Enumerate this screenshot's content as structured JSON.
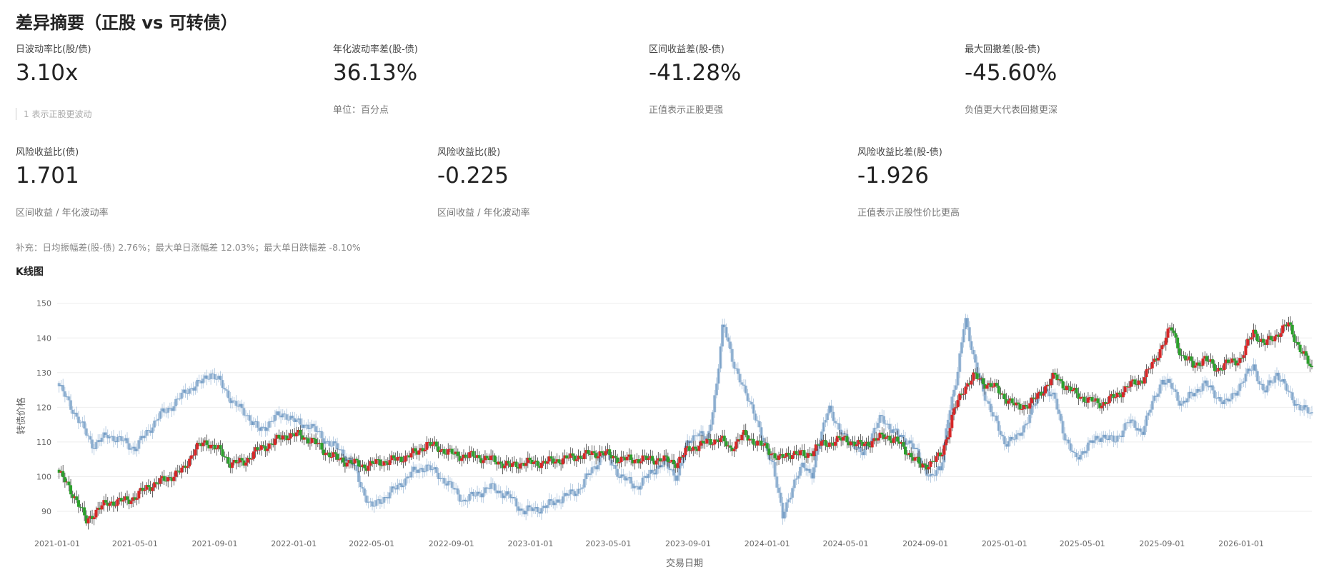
{
  "summary": {
    "title": "差异摘要（正股 vs 可转债）",
    "row1": [
      {
        "label": "日波动率比(股/债)",
        "value": "3.10x",
        "note": "1 表示正股更波动"
      },
      {
        "label": "年化波动率差(股-债)",
        "value": "36.13%",
        "note": "单位：百分点"
      },
      {
        "label": "区间收益差(股-债)",
        "value": "-41.28%",
        "note": "正值表示正股更强"
      },
      {
        "label": "最大回撤差(股-债)",
        "value": "-45.60%",
        "note": "负值更大代表回撤更深"
      }
    ],
    "row2": [
      {
        "label": "风险收益比(债)",
        "value": "1.701",
        "note": "区间收益 / 年化波动率"
      },
      {
        "label": "风险收益比(股)",
        "value": "-0.225",
        "note": "区间收益 / 年化波动率"
      },
      {
        "label": "风险收益比差(股-债)",
        "value": "-1.926",
        "note": "正值表示正股性价比更高"
      }
    ],
    "supplement": "补充：日均振幅差(股-债) 2.76%；最大单日涨幅差 12.03%；最大单日跌幅差 -8.10%"
  },
  "kline_title": "K线图",
  "colors": {
    "up": "#d62728",
    "down": "#2ca02c",
    "stock": "#4a7fb5",
    "grid": "#eeeeee",
    "axis": "#666666"
  },
  "chart_data": {
    "type": "candlestick",
    "xlabel": "交易日期",
    "ylabel": "转债价格",
    "ylim": [
      83,
      152
    ],
    "yticks": [
      90,
      100,
      110,
      120,
      130,
      140,
      150
    ],
    "xlim": [
      "2021-01-01",
      "2026-04-20"
    ],
    "xticks": [
      "2021-01-01",
      "2021-05-01",
      "2021-09-01",
      "2022-01-01",
      "2022-05-01",
      "2022-09-01",
      "2023-01-01",
      "2023-05-01",
      "2023-09-01",
      "2024-01-01",
      "2024-05-01",
      "2024-09-01",
      "2025-01-01",
      "2025-05-01",
      "2025-09-01",
      "2026-01-01"
    ],
    "series": [
      {
        "id": "bond",
        "style": "candle",
        "points": [
          [
            "2021-01-01",
            102
          ],
          [
            "2021-01-15",
            98
          ],
          [
            "2021-02-01",
            93
          ],
          [
            "2021-02-15",
            87
          ],
          [
            "2021-03-01",
            90
          ],
          [
            "2021-03-20",
            92.5
          ],
          [
            "2021-04-15",
            93
          ],
          [
            "2021-05-01",
            94
          ],
          [
            "2021-05-20",
            97
          ],
          [
            "2021-06-15",
            99
          ],
          [
            "2021-07-15",
            102
          ],
          [
            "2021-08-01",
            108
          ],
          [
            "2021-08-20",
            110
          ],
          [
            "2021-09-05",
            108
          ],
          [
            "2021-09-25",
            104
          ],
          [
            "2021-10-15",
            104
          ],
          [
            "2021-11-01",
            107
          ],
          [
            "2021-12-01",
            110
          ],
          [
            "2021-12-20",
            112
          ],
          [
            "2022-01-10",
            112
          ],
          [
            "2022-02-01",
            110
          ],
          [
            "2022-02-20",
            107
          ],
          [
            "2022-03-10",
            105
          ],
          [
            "2022-04-01",
            104
          ],
          [
            "2022-04-20",
            103
          ],
          [
            "2022-05-10",
            104
          ],
          [
            "2022-06-10",
            105
          ],
          [
            "2022-07-10",
            107
          ],
          [
            "2022-07-25",
            109.5
          ],
          [
            "2022-08-15",
            108
          ],
          [
            "2022-09-10",
            106
          ],
          [
            "2022-10-01",
            106
          ],
          [
            "2022-11-01",
            105
          ],
          [
            "2022-12-01",
            103
          ],
          [
            "2022-12-20",
            104
          ],
          [
            "2023-01-20",
            104
          ],
          [
            "2023-02-20",
            105
          ],
          [
            "2023-03-20",
            106
          ],
          [
            "2023-04-20",
            107
          ],
          [
            "2023-05-20",
            105
          ],
          [
            "2023-06-20",
            105
          ],
          [
            "2023-07-20",
            105
          ],
          [
            "2023-08-15",
            104
          ],
          [
            "2023-09-01",
            108
          ],
          [
            "2023-09-20",
            109
          ],
          [
            "2023-10-01",
            110
          ],
          [
            "2023-10-20",
            111
          ],
          [
            "2023-11-05",
            108
          ],
          [
            "2023-11-25",
            112
          ],
          [
            "2023-12-15",
            110
          ],
          [
            "2024-01-01",
            108
          ],
          [
            "2024-01-20",
            105
          ],
          [
            "2024-02-10",
            107
          ],
          [
            "2024-03-01",
            106
          ],
          [
            "2024-03-20",
            109
          ],
          [
            "2024-04-10",
            110
          ],
          [
            "2024-05-01",
            111
          ],
          [
            "2024-05-20",
            109
          ],
          [
            "2024-06-10",
            110
          ],
          [
            "2024-07-01",
            112
          ],
          [
            "2024-07-20",
            110
          ],
          [
            "2024-08-10",
            106
          ],
          [
            "2024-08-25",
            103
          ],
          [
            "2024-09-10",
            104
          ],
          [
            "2024-09-25",
            106
          ],
          [
            "2024-10-05",
            112
          ],
          [
            "2024-10-15",
            119
          ],
          [
            "2024-11-01",
            126
          ],
          [
            "2024-11-15",
            129
          ],
          [
            "2024-12-01",
            127
          ],
          [
            "2024-12-15",
            126
          ],
          [
            "2025-01-01",
            123
          ],
          [
            "2025-01-20",
            120
          ],
          [
            "2025-02-10",
            121
          ],
          [
            "2025-03-01",
            125
          ],
          [
            "2025-03-20",
            129
          ],
          [
            "2025-04-05",
            126
          ],
          [
            "2025-04-20",
            124
          ],
          [
            "2025-05-10",
            122
          ],
          [
            "2025-06-01",
            121
          ],
          [
            "2025-06-20",
            123
          ],
          [
            "2025-07-10",
            126
          ],
          [
            "2025-08-01",
            128
          ],
          [
            "2025-08-20",
            133
          ],
          [
            "2025-09-01",
            138
          ],
          [
            "2025-09-15",
            143
          ],
          [
            "2025-10-01",
            135
          ],
          [
            "2025-10-20",
            132
          ],
          [
            "2025-11-05",
            134
          ],
          [
            "2025-11-25",
            131
          ],
          [
            "2025-12-15",
            133
          ],
          [
            "2026-01-01",
            134
          ],
          [
            "2026-01-20",
            142
          ],
          [
            "2026-02-05",
            138
          ],
          [
            "2026-02-25",
            141
          ],
          [
            "2026-03-15",
            144
          ],
          [
            "2026-04-01",
            137
          ],
          [
            "2026-04-20",
            131
          ]
        ]
      },
      {
        "id": "stock",
        "style": "candle-faded",
        "points": [
          [
            "2021-01-01",
            127
          ],
          [
            "2021-01-20",
            121
          ],
          [
            "2021-02-10",
            114
          ],
          [
            "2021-02-25",
            109
          ],
          [
            "2021-03-20",
            112
          ],
          [
            "2021-04-15",
            110
          ],
          [
            "2021-05-01",
            108
          ],
          [
            "2021-05-20",
            113
          ],
          [
            "2021-06-10",
            118
          ],
          [
            "2021-07-01",
            121
          ],
          [
            "2021-07-20",
            125
          ],
          [
            "2021-08-10",
            127
          ],
          [
            "2021-08-25",
            130
          ],
          [
            "2021-09-10",
            127
          ],
          [
            "2021-10-01",
            121
          ],
          [
            "2021-10-20",
            118
          ],
          [
            "2021-11-10",
            113
          ],
          [
            "2021-12-01",
            117
          ],
          [
            "2021-12-20",
            118
          ],
          [
            "2022-01-10",
            115
          ],
          [
            "2022-01-25",
            115
          ],
          [
            "2022-02-15",
            111
          ],
          [
            "2022-03-10",
            108
          ],
          [
            "2022-04-01",
            104
          ],
          [
            "2022-04-15",
            97
          ],
          [
            "2022-05-01",
            91
          ],
          [
            "2022-05-20",
            94
          ],
          [
            "2022-06-10",
            97
          ],
          [
            "2022-07-01",
            101
          ],
          [
            "2022-07-25",
            103
          ],
          [
            "2022-08-15",
            100
          ],
          [
            "2022-09-01",
            97
          ],
          [
            "2022-09-20",
            93
          ],
          [
            "2022-10-10",
            95
          ],
          [
            "2022-11-01",
            97
          ],
          [
            "2022-12-01",
            94
          ],
          [
            "2022-12-20",
            90
          ],
          [
            "2023-01-20",
            91
          ],
          [
            "2023-02-20",
            94
          ],
          [
            "2023-03-15",
            96
          ],
          [
            "2023-04-10",
            103
          ],
          [
            "2023-04-25",
            107
          ],
          [
            "2023-05-20",
            100
          ],
          [
            "2023-06-15",
            97
          ],
          [
            "2023-07-10",
            102
          ],
          [
            "2023-07-25",
            104
          ],
          [
            "2023-08-15",
            100
          ],
          [
            "2023-09-01",
            110
          ],
          [
            "2023-09-15",
            113
          ],
          [
            "2023-10-01",
            110
          ],
          [
            "2023-10-15",
            127
          ],
          [
            "2023-10-25",
            144
          ],
          [
            "2023-11-10",
            133
          ],
          [
            "2023-11-25",
            125
          ],
          [
            "2023-12-10",
            120
          ],
          [
            "2023-12-25",
            110
          ],
          [
            "2024-01-10",
            104
          ],
          [
            "2024-01-25",
            88
          ],
          [
            "2024-02-10",
            98
          ],
          [
            "2024-02-25",
            103
          ],
          [
            "2024-03-10",
            101
          ],
          [
            "2024-03-25",
            112
          ],
          [
            "2024-04-05",
            121
          ],
          [
            "2024-04-20",
            113
          ],
          [
            "2024-05-10",
            110
          ],
          [
            "2024-05-25",
            106
          ],
          [
            "2024-06-10",
            112
          ],
          [
            "2024-06-25",
            117
          ],
          [
            "2024-07-10",
            114
          ],
          [
            "2024-07-25",
            111
          ],
          [
            "2024-08-10",
            110
          ],
          [
            "2024-08-25",
            104
          ],
          [
            "2024-09-10",
            100
          ],
          [
            "2024-09-25",
            102
          ],
          [
            "2024-10-05",
            117
          ],
          [
            "2024-10-20",
            128
          ],
          [
            "2024-11-01",
            147
          ],
          [
            "2024-11-15",
            133
          ],
          [
            "2024-12-01",
            124
          ],
          [
            "2024-12-15",
            117
          ],
          [
            "2025-01-01",
            110
          ],
          [
            "2025-01-20",
            111
          ],
          [
            "2025-02-10",
            118
          ],
          [
            "2025-03-01",
            126
          ],
          [
            "2025-03-20",
            122
          ],
          [
            "2025-04-05",
            111
          ],
          [
            "2025-04-20",
            105
          ],
          [
            "2025-05-10",
            109
          ],
          [
            "2025-06-01",
            112
          ],
          [
            "2025-06-20",
            110
          ],
          [
            "2025-07-10",
            116
          ],
          [
            "2025-08-01",
            113
          ],
          [
            "2025-08-15",
            120
          ],
          [
            "2025-09-01",
            128
          ],
          [
            "2025-09-15",
            126
          ],
          [
            "2025-10-01",
            121
          ],
          [
            "2025-10-20",
            124
          ],
          [
            "2025-11-05",
            127
          ],
          [
            "2025-11-25",
            123
          ],
          [
            "2025-12-10",
            121
          ],
          [
            "2026-01-01",
            127
          ],
          [
            "2026-01-20",
            132
          ],
          [
            "2026-02-05",
            124
          ],
          [
            "2026-02-25",
            130
          ],
          [
            "2026-03-15",
            124
          ],
          [
            "2026-04-01",
            120
          ],
          [
            "2026-04-20",
            118
          ]
        ]
      }
    ]
  }
}
